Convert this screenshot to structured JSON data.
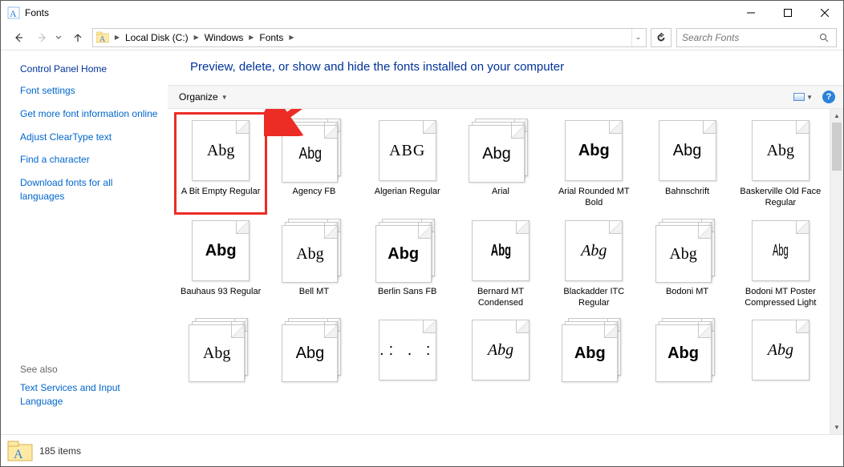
{
  "window": {
    "title": "Fonts"
  },
  "breadcrumbs": [
    "Local Disk (C:)",
    "Windows",
    "Fonts"
  ],
  "search": {
    "placeholder": "Search Fonts"
  },
  "sidebar": {
    "heading": "Control Panel Home",
    "links": [
      "Font settings",
      "Get more font information online",
      "Adjust ClearType text",
      "Find a character",
      "Download fonts for all languages"
    ],
    "see_also_heading": "See also",
    "see_also_links": [
      "Text Services and Input Language"
    ]
  },
  "page_heading": "Preview, delete, or show and hide the fonts installed on your computer",
  "toolbar": {
    "organize_label": "Organize"
  },
  "fonts": [
    {
      "name": "A Bit Empty Regular",
      "sample": "Abg",
      "family": false,
      "style": "samp-serif",
      "highlighted": true
    },
    {
      "name": "Agency FB",
      "sample": "Abg",
      "family": true,
      "style": "samp-cond"
    },
    {
      "name": "Algerian Regular",
      "sample": "ABG",
      "family": false,
      "style": "samp-sc"
    },
    {
      "name": "Arial",
      "sample": "Abg",
      "family": true,
      "style": ""
    },
    {
      "name": "Arial Rounded MT Bold",
      "sample": "Abg",
      "family": false,
      "style": "samp-round"
    },
    {
      "name": "Bahnschrift",
      "sample": "Abg",
      "family": false,
      "style": ""
    },
    {
      "name": "Baskerville Old Face Regular",
      "sample": "Abg",
      "family": false,
      "style": "samp-serif"
    },
    {
      "name": "Bauhaus 93 Regular",
      "sample": "Abg",
      "family": false,
      "style": "samp-bauhaus"
    },
    {
      "name": "Bell MT",
      "sample": "Abg",
      "family": true,
      "style": "samp-serif"
    },
    {
      "name": "Berlin Sans FB",
      "sample": "Abg",
      "family": true,
      "style": "samp-bold"
    },
    {
      "name": "Bernard MT Condensed",
      "sample": "Abg",
      "family": false,
      "style": "samp-condbold"
    },
    {
      "name": "Blackadder ITC Regular",
      "sample": "Abg",
      "family": false,
      "style": "samp-script"
    },
    {
      "name": "Bodoni MT",
      "sample": "Abg",
      "family": true,
      "style": "samp-serif"
    },
    {
      "name": "Bodoni MT Poster Compressed Light",
      "sample": "Abg",
      "family": false,
      "style": "samp-thin"
    },
    {
      "name": "",
      "sample": "Abg",
      "family": true,
      "style": "samp-serif"
    },
    {
      "name": "",
      "sample": "Abg",
      "family": true,
      "style": ""
    },
    {
      "name": "",
      "sample": ".: . :",
      "family": false,
      "style": "samp-dots"
    },
    {
      "name": "",
      "sample": "Abg",
      "family": false,
      "style": "samp-hand"
    },
    {
      "name": "",
      "sample": "Abg",
      "family": true,
      "style": "samp-impact"
    },
    {
      "name": "",
      "sample": "Abg",
      "family": true,
      "style": "samp-impact"
    },
    {
      "name": "",
      "sample": "Abg",
      "family": false,
      "style": "samp-script"
    }
  ],
  "status": {
    "count_text": "185 items"
  }
}
